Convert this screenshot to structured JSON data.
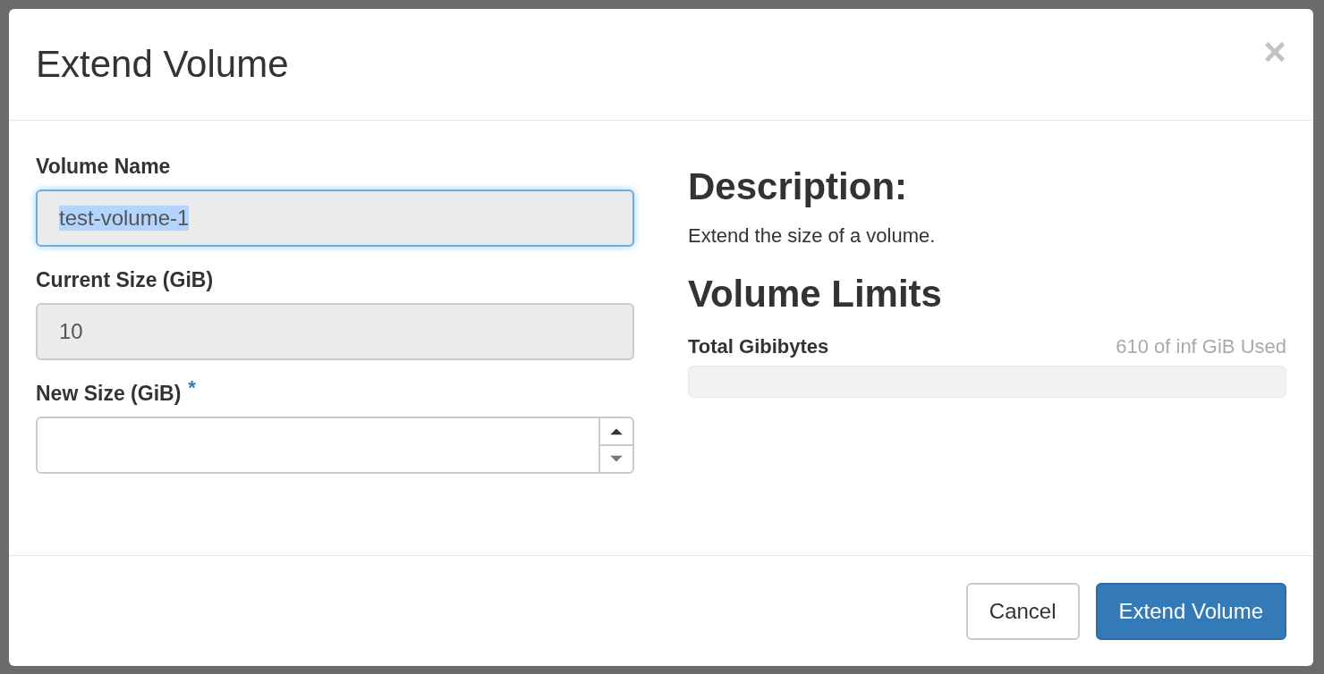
{
  "dialog": {
    "title": "Extend Volume",
    "close_label": "×"
  },
  "form": {
    "fields": [
      {
        "kind": "text",
        "label": "Volume Name",
        "value": "test-volume-1",
        "disabled": true,
        "focused": true,
        "value_selected": true
      },
      {
        "kind": "text",
        "label": "Current Size (GiB)",
        "value": "10",
        "disabled": true,
        "focused": false
      },
      {
        "kind": "number",
        "label": "New Size (GiB)",
        "disabled": false,
        "focused": false,
        "required_mark": "*"
      }
    ]
  },
  "description": {
    "heading": "Description:",
    "text": "Extend the size of a volume."
  },
  "limits": {
    "heading": "Volume Limits",
    "items": [
      {
        "label": "Total Gibibytes",
        "reading": "610 of inf GiB Used",
        "level": 0
      }
    ]
  },
  "buttons": [
    {
      "label": "Cancel",
      "kind": "default"
    },
    {
      "label": "Extend Volume",
      "kind": "primary"
    }
  ]
}
